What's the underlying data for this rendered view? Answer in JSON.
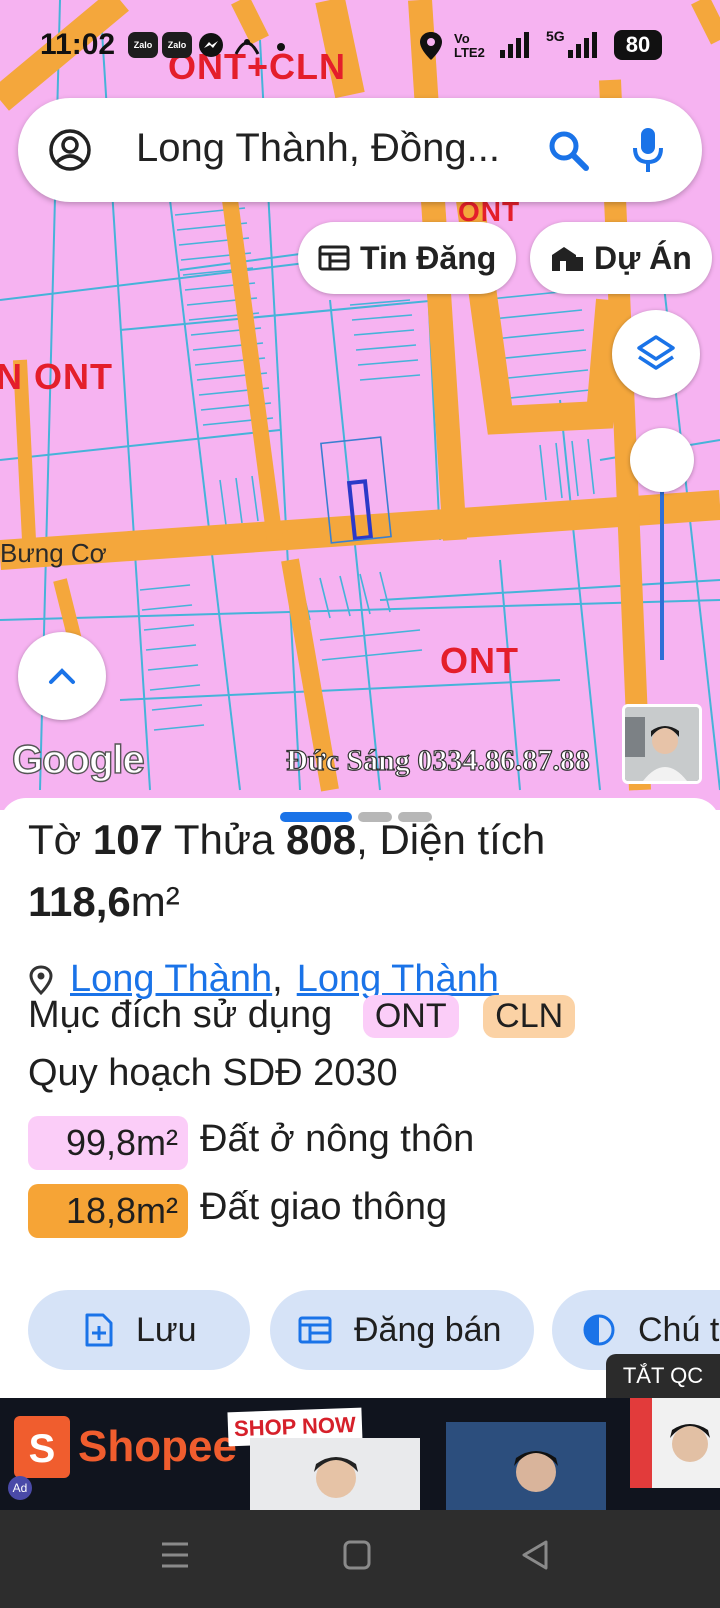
{
  "status_bar": {
    "time": "11:02",
    "notification_icons": [
      "zalo-icon",
      "zalo-icon",
      "messenger-icon",
      "antenna-icon",
      "dot-icon"
    ],
    "zalo_label": "Zalo",
    "network_label": "Vo LTE2",
    "five_g": "5G",
    "battery": "80"
  },
  "map": {
    "zone_labels": [
      "ONT+CLN",
      "ONT",
      "N ONT",
      "ONT"
    ],
    "road_label": "Bưng Cơ",
    "google_logo": "Google",
    "watermark": "Đức Sáng 0334.86.87.88"
  },
  "search": {
    "query": "Long Thành, Đồng..."
  },
  "chips": {
    "tin_dang": "Tin Đăng",
    "du_an": "Dự Án"
  },
  "sheet": {
    "title_prefix": "Tờ ",
    "to_number": "107",
    "thua_label": " Thửa ",
    "thua_number": "808",
    "area_label": ", Diện tích",
    "area_value": "118,6",
    "area_unit": "m²",
    "location_1": "Long Thành",
    "location_sep": ",",
    "location_2": "Long Thành",
    "purpose_label": "Mục đích sử dụng",
    "tags": [
      {
        "code": "ONT",
        "color": "#fbcdf8"
      },
      {
        "code": "CLN",
        "color": "#fbd2a5"
      }
    ],
    "plan_label": "Quy hoạch SDĐ 2030",
    "land_breakdown": [
      {
        "area": "99,8m²",
        "desc": "Đất ở nông thôn",
        "color": "#fbcdf8"
      },
      {
        "area": "18,8m²",
        "desc": "Đất giao thông",
        "color": "#f6a436"
      }
    ],
    "actions": {
      "luu": "Lưu",
      "dang_ban": "Đăng bán",
      "chu_thich": "Chú t"
    }
  },
  "ad": {
    "close_label": "TẮT QC",
    "brand": "Shopee",
    "shop_now": "SHOP NOW"
  },
  "colors": {
    "accent": "#1a73e8",
    "map_bg": "#f6b3f1",
    "road": "#f4a73c",
    "button_bg": "#d6e3f7"
  }
}
